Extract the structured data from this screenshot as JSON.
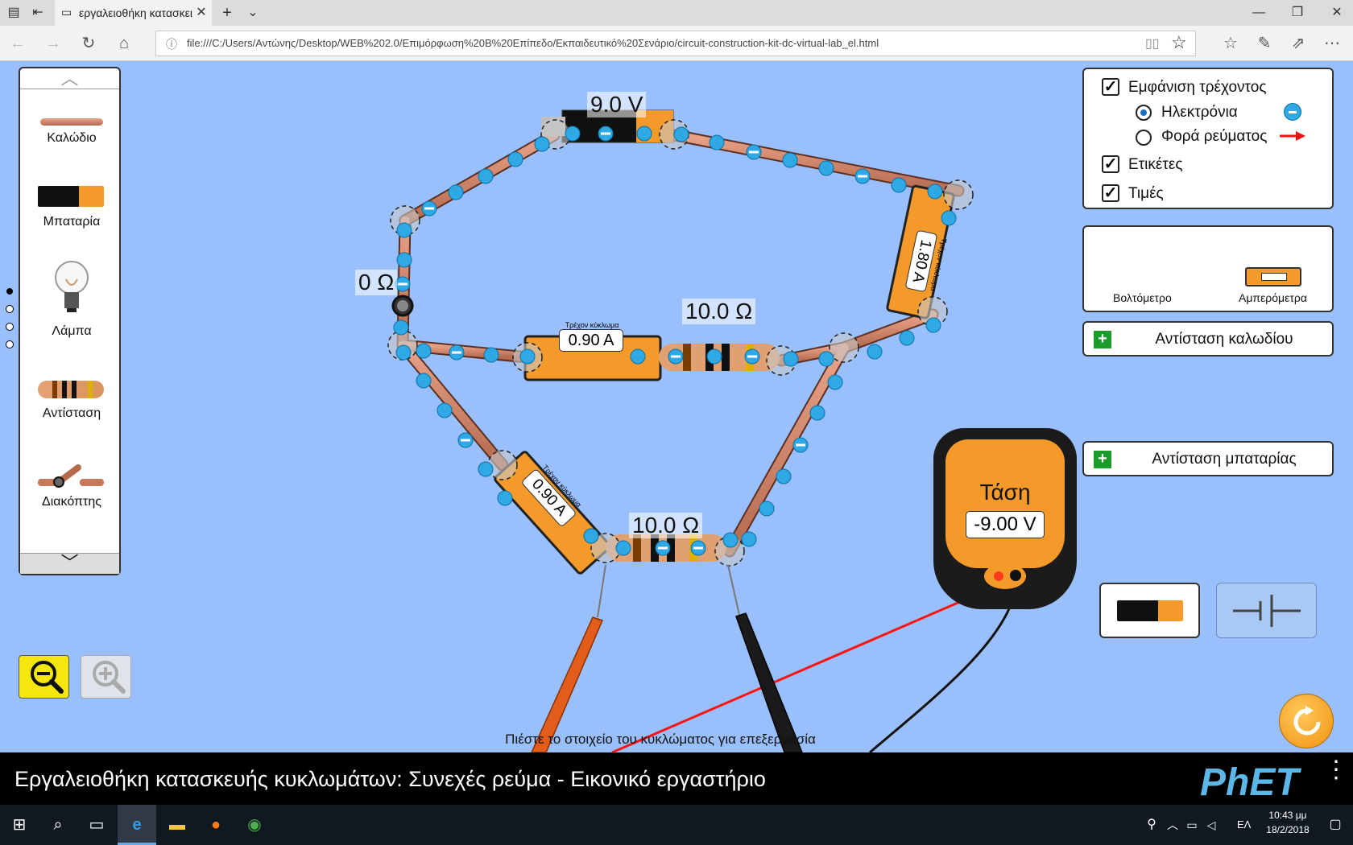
{
  "browser": {
    "tab_title": "εργαλειοθήκη κατασκει",
    "url": "file:///C:/Users/Αντώνης/Desktop/WEB%202.0/Επιμόρφωση%20Β%20Επίπεδο/Εκπαιδευτικό%20Σενάριο/circuit-construction-kit-dc-virtual-lab_el.html"
  },
  "toolbox": {
    "items": [
      {
        "label": "Καλώδιο",
        "icon": "wire-icon"
      },
      {
        "label": "Μπαταρία",
        "icon": "battery-icon"
      },
      {
        "label": "Λάμπα",
        "icon": "lightbulb-icon"
      },
      {
        "label": "Αντίσταση",
        "icon": "resistor-icon"
      },
      {
        "label": "Διακόπτης",
        "icon": "switch-icon"
      }
    ]
  },
  "control_panel": {
    "show_current": "Εμφάνιση τρέχοντος",
    "electrons": "Ηλεκτρόνια",
    "conventional": "Φορά ρεύματος",
    "labels": "Ετικέτες",
    "values": "Τιμές"
  },
  "sensors": {
    "voltmeter": "Βολτόμετρο",
    "ammeter": "Αμπερόμετρα"
  },
  "accordions": {
    "wire_resistance": "Αντίσταση καλωδίου",
    "battery_resistance": "Αντίσταση μπαταρίας"
  },
  "circuit": {
    "battery_voltage": "9.0 V",
    "switch_resistance": "0 Ω",
    "resistor1": "10.0 Ω",
    "resistor2": "10.0 Ω",
    "ammeter_label": "Τρέχον κύκλωμα",
    "ammeter1": "0.90 A",
    "ammeter2": "0.90 A",
    "ammeter3": "1.80 A"
  },
  "voltmeter": {
    "title": "Τάση",
    "reading": "-9.00 V"
  },
  "hint": "Πιέστε το στοιχείο του κυκλώματος για επεξεργασία",
  "sim_title": "Εργαλειοθήκη κατασκευής κυκλωμάτων: Συνεχές ρεύμα - Εικονικό εργαστήριο",
  "phet_logo": "PhET",
  "taskbar": {
    "lang": "ΕΛ",
    "time": "10:43 μμ",
    "date": "18/2/2018"
  }
}
